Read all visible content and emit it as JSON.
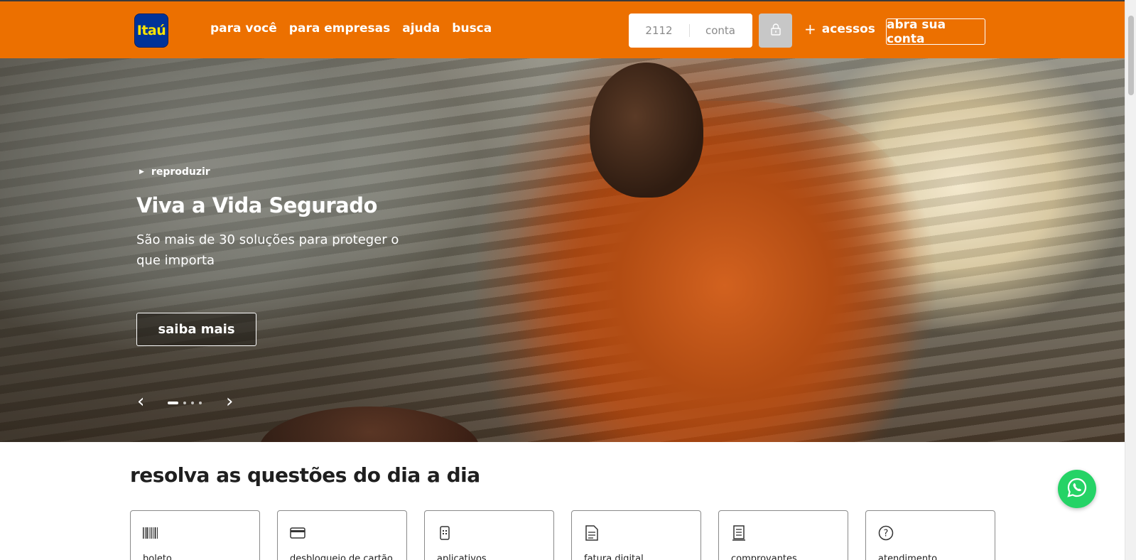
{
  "brand": {
    "logo_text": "Itaú",
    "accent": "#ec7000",
    "logo_bg": "#003399",
    "logo_fg": "#ffe500"
  },
  "nav": {
    "items": [
      "para você",
      "para empresas",
      "ajuda",
      "busca"
    ]
  },
  "login": {
    "agency_value": "2112",
    "account_placeholder": "conta",
    "lock_icon": "lock-icon"
  },
  "header_actions": {
    "acessos_label": "acessos",
    "open_account_label": "abra sua conta"
  },
  "hero": {
    "play_label": "reproduzir",
    "title": "Viva a Vida Segurado",
    "subtitle": "São mais de 30 soluções para proteger o que importa",
    "cta_label": "saiba mais",
    "slides_count": 4,
    "active_slide": 1
  },
  "quick": {
    "title": "resolva as questões do dia a dia",
    "cards": [
      {
        "label": "boleto",
        "icon": "barcode-icon"
      },
      {
        "label": "desbloqueio de cartão",
        "icon": "card-icon"
      },
      {
        "label": "aplicativos",
        "icon": "phone-icon"
      },
      {
        "label": "fatura digital",
        "icon": "invoice-icon"
      },
      {
        "label": "comprovantes",
        "icon": "receipt-icon"
      },
      {
        "label": "atendimento",
        "icon": "help-icon"
      }
    ]
  },
  "whatsapp": {
    "icon": "whatsapp-icon",
    "color": "#25d366"
  }
}
